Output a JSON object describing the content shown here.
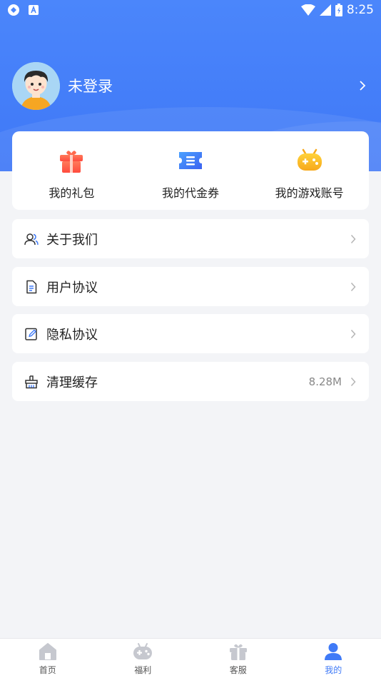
{
  "status_bar": {
    "time": "8:25"
  },
  "profile": {
    "login_text": "未登录"
  },
  "quick_actions": [
    {
      "label": "我的礼包",
      "icon": "gift-icon"
    },
    {
      "label": "我的代金券",
      "icon": "coupon-icon"
    },
    {
      "label": "我的游戏账号",
      "icon": "gamepad-icon"
    }
  ],
  "menu": [
    {
      "label": "关于我们",
      "icon": "users-icon",
      "value": ""
    },
    {
      "label": "用户协议",
      "icon": "document-icon",
      "value": ""
    },
    {
      "label": "隐私协议",
      "icon": "edit-icon",
      "value": ""
    },
    {
      "label": "清理缓存",
      "icon": "broom-icon",
      "value": "8.28M"
    }
  ],
  "tabs": [
    {
      "label": "首页",
      "icon": "home-icon",
      "active": false
    },
    {
      "label": "福利",
      "icon": "gamepad-icon",
      "active": false
    },
    {
      "label": "客服",
      "icon": "gift-icon",
      "active": false
    },
    {
      "label": "我的",
      "icon": "person-icon",
      "active": true
    }
  ],
  "colors": {
    "accent": "#3f7af7",
    "header": "#4b86fb",
    "background": "#f3f4f7"
  }
}
